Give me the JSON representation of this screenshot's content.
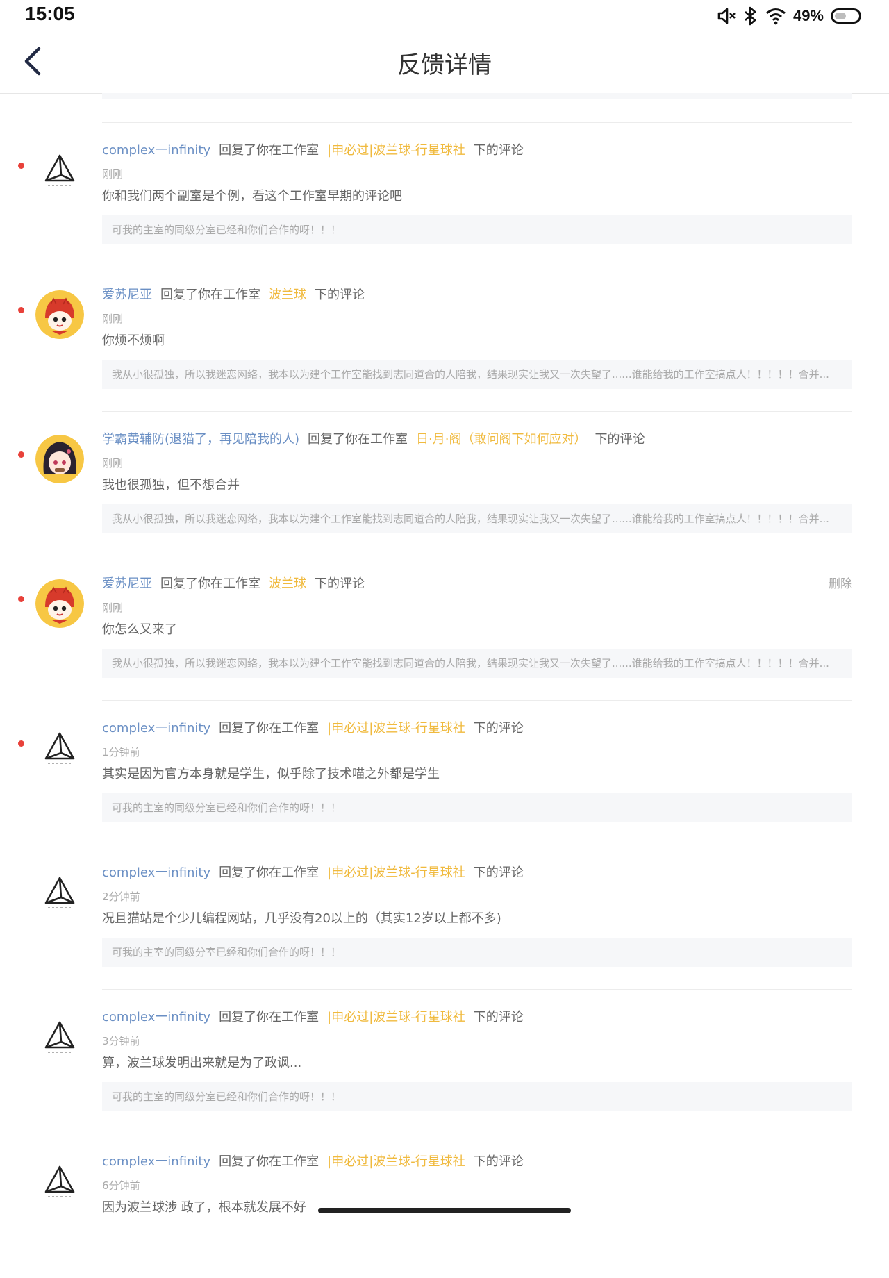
{
  "status_bar": {
    "time": "15:05",
    "battery_percent": "49%",
    "battery_level": 0.49,
    "icons": [
      "speaker-muted-icon",
      "bluetooth-icon",
      "wifi-icon",
      "battery-icon"
    ]
  },
  "nav": {
    "title": "反馈详情",
    "back_icon": "chevron-left-icon"
  },
  "reply_text": "回复了你在工作室",
  "suffix_text": "下的评论",
  "delete_label": "删除",
  "colors": {
    "username": "#6a8fc4",
    "studio": "#f0ba3e",
    "unread_dot": "#e8413a",
    "quote_bg": "#f6f7f9"
  },
  "notifications": [
    {
      "user": "complex一infinity",
      "avatar": "triangle-logo-avatar",
      "studio": "|申必过|波兰球-行星球社",
      "time": "刚刚",
      "content": "你和我们两个副室是个例，看这个工作室早期的评论吧",
      "quote": "可我的主室的同级分室已经和你们合作的呀！！！",
      "unread": true
    },
    {
      "user": "爱苏尼亚",
      "avatar": "red-mascot-avatar",
      "studio": "波兰球",
      "time": "刚刚",
      "content": "你烦不烦啊",
      "quote": "我从小很孤独，所以我迷恋网络，我本以为建个工作室能找到志同道合的人陪我，结果现实让我又一次失望了......谁能给我的工作室搞点人！！！！！合并...",
      "unread": true
    },
    {
      "user": "学霸黄辅防(退猫了，再见陪我的人)",
      "avatar": "anime-girl-avatar",
      "studio": "日·月·阁（敢问阁下如何应对）",
      "time": "刚刚",
      "content": "我也很孤独，但不想合并",
      "quote": "我从小很孤独，所以我迷恋网络，我本以为建个工作室能找到志同道合的人陪我，结果现实让我又一次失望了......谁能给我的工作室搞点人！！！！！合并...",
      "unread": true
    },
    {
      "user": "爱苏尼亚",
      "avatar": "red-mascot-avatar",
      "studio": "波兰球",
      "time": "刚刚",
      "content": "你怎么又来了",
      "quote": "我从小很孤独，所以我迷恋网络，我本以为建个工作室能找到志同道合的人陪我，结果现实让我又一次失望了......谁能给我的工作室搞点人！！！！！合并...",
      "unread": true,
      "deletable": true
    },
    {
      "user": "complex一infinity",
      "avatar": "triangle-logo-avatar",
      "studio": "|申必过|波兰球-行星球社",
      "time": "1分钟前",
      "content": "其实是因为官方本身就是学生，似乎除了技术喵之外都是学生",
      "quote": "可我的主室的同级分室已经和你们合作的呀！！！",
      "unread": true
    },
    {
      "user": "complex一infinity",
      "avatar": "triangle-logo-avatar",
      "studio": "|申必过|波兰球-行星球社",
      "time": "2分钟前",
      "content": "况且猫站是个少儿编程网站，几乎没有20以上的（其实12岁以上都不多)",
      "quote": "可我的主室的同级分室已经和你们合作的呀！！！",
      "unread": false
    },
    {
      "user": "complex一infinity",
      "avatar": "triangle-logo-avatar",
      "studio": "|申必过|波兰球-行星球社",
      "time": "3分钟前",
      "content": "算，波兰球发明出来就是为了政讽...",
      "quote": "可我的主室的同级分室已经和你们合作的呀！！！",
      "unread": false
    },
    {
      "user": "complex一infinity",
      "avatar": "triangle-logo-avatar",
      "studio": "|申必过|波兰球-行星球社",
      "time": "6分钟前",
      "content": "因为波兰球涉 政了，根本就发展不好",
      "quote": "",
      "unread": false
    }
  ]
}
